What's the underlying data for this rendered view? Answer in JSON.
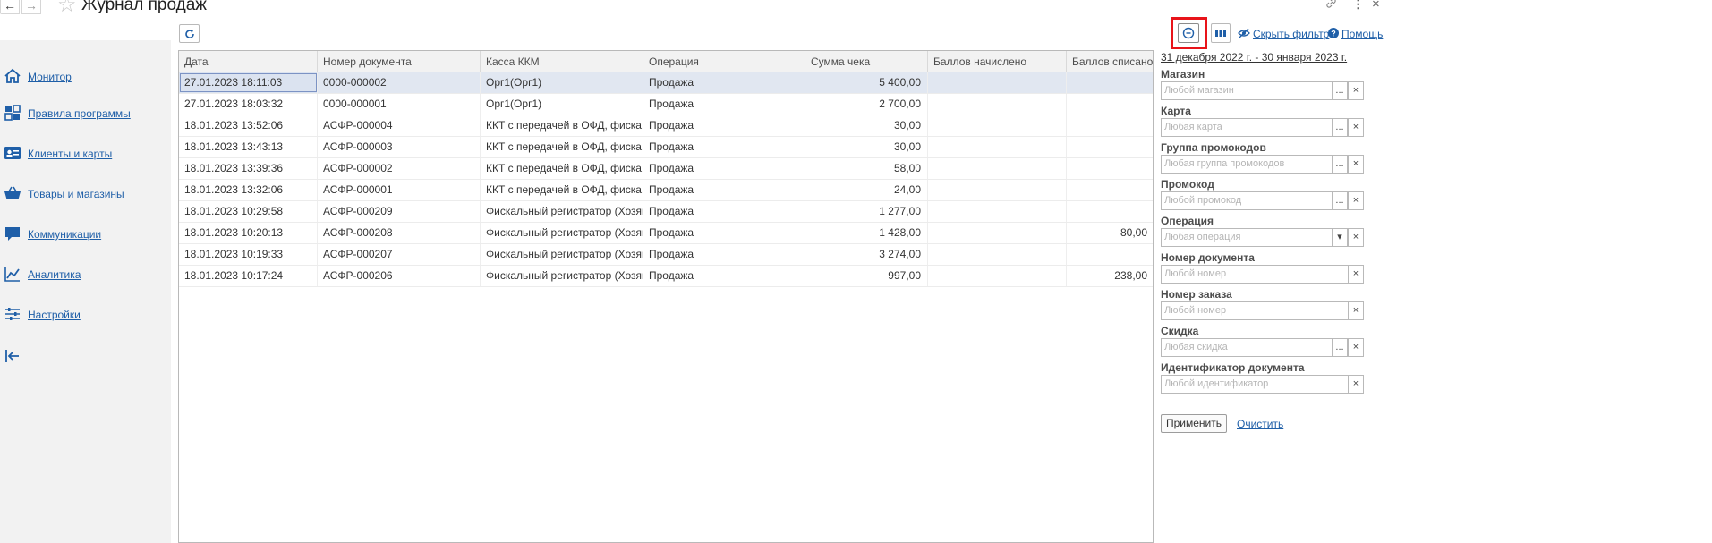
{
  "window": {
    "title": "Журнал продаж"
  },
  "icons": {
    "back": "arrow-left-icon",
    "forward": "arrow-right-icon",
    "favorite": "star-icon",
    "link": "link-icon",
    "more": "more-vertical-icon",
    "close": "close-icon",
    "refresh": "refresh-icon",
    "filter_toggle": "minus-circle-icon",
    "columns": "columns-icon",
    "hide_filter": "eye-off-icon",
    "help": "help-icon",
    "collapse": "collapse-left-icon"
  },
  "glyphs": {
    "back": "←",
    "forward": "→",
    "favorite": "☆",
    "link": "🔗",
    "more": "⋮",
    "close": "×",
    "dots": "...",
    "clear": "×",
    "dropdown": "▾"
  },
  "sidebar": {
    "items": [
      {
        "label": "Монитор",
        "icon": "home-icon"
      },
      {
        "label": "Правила программы",
        "icon": "dashboard-icon"
      },
      {
        "label": "Клиенты и карты",
        "icon": "id-card-icon"
      },
      {
        "label": "Товары и магазины",
        "icon": "basket-icon"
      },
      {
        "label": "Коммуникации",
        "icon": "chat-icon"
      },
      {
        "label": "Аналитика",
        "icon": "chart-line-icon"
      },
      {
        "label": "Настройки",
        "icon": "sliders-icon"
      }
    ]
  },
  "toolbar": {
    "hide_filter_label": "Скрыть фильтр",
    "help_label": "Помощь"
  },
  "table": {
    "columns": [
      "Дата",
      "Номер документа",
      "Касса ККМ",
      "Операция",
      "Сумма чека",
      "Баллов начислено",
      "Баллов списано"
    ],
    "rows": [
      [
        "27.01.2023 18:11:03",
        "0000-000002",
        "Орг1(Орг1)",
        "Продажа",
        "5 400,00",
        "",
        ""
      ],
      [
        "27.01.2023 18:03:32",
        "0000-000001",
        "Орг1(Орг1)",
        "Продажа",
        "2 700,00",
        "",
        ""
      ],
      [
        "18.01.2023 13:52:06",
        "АСФР-000004",
        "ККТ с передачей в ОФД, фиска...",
        "Продажа",
        "30,00",
        "",
        ""
      ],
      [
        "18.01.2023 13:43:13",
        "АСФР-000003",
        "ККТ с передачей в ОФД, фиска...",
        "Продажа",
        "30,00",
        "",
        ""
      ],
      [
        "18.01.2023 13:39:36",
        "АСФР-000002",
        "ККТ с передачей в ОФД, фиска...",
        "Продажа",
        "58,00",
        "",
        ""
      ],
      [
        "18.01.2023 13:32:06",
        "АСФР-000001",
        "ККТ с передачей в ОФД, фиска...",
        "Продажа",
        "24,00",
        "",
        ""
      ],
      [
        "18.01.2023 10:29:58",
        "АСФР-000209",
        "Фискальный регистратор (Хозяй...",
        "Продажа",
        "1 277,00",
        "",
        ""
      ],
      [
        "18.01.2023 10:20:13",
        "АСФР-000208",
        "Фискальный регистратор (Хозяй...",
        "Продажа",
        "1 428,00",
        "",
        "80,00"
      ],
      [
        "18.01.2023 10:19:33",
        "АСФР-000207",
        "Фискальный регистратор (Хозяй...",
        "Продажа",
        "3 274,00",
        "",
        ""
      ],
      [
        "18.01.2023 10:17:24",
        "АСФР-000206",
        "Фискальный регистратор (Хозяй...",
        "Продажа",
        "997,00",
        "",
        "238,00"
      ]
    ]
  },
  "filter": {
    "period": "31 декабря 2022 г. - 30 января 2023 г.",
    "fields": [
      {
        "label": "Магазин",
        "placeholder": "Любой магазин",
        "buttons": [
          "dots",
          "clear"
        ]
      },
      {
        "label": "Карта",
        "placeholder": "Любая карта",
        "buttons": [
          "dots",
          "clear"
        ]
      },
      {
        "label": "Группа промокодов",
        "placeholder": "Любая группа промокодов",
        "buttons": [
          "dots",
          "clear"
        ]
      },
      {
        "label": "Промокод",
        "placeholder": "Любой промокод",
        "buttons": [
          "dots",
          "clear"
        ]
      },
      {
        "label": "Операция",
        "placeholder": "Любая операция",
        "buttons": [
          "dropdown",
          "clear"
        ]
      },
      {
        "label": "Номер документа",
        "placeholder": "Любой номер",
        "buttons": [
          "clear"
        ]
      },
      {
        "label": "Номер заказа",
        "placeholder": "Любой номер",
        "buttons": [
          "clear"
        ]
      },
      {
        "label": "Скидка",
        "placeholder": "Любая скидка",
        "buttons": [
          "dots",
          "clear"
        ]
      },
      {
        "label": "Идентификатор документа",
        "placeholder": "Любой идентификатор",
        "buttons": [
          "clear"
        ]
      }
    ],
    "apply_label": "Применить",
    "clear_label": "Очистить"
  },
  "colors": {
    "link": "#1f5fa8",
    "highlight": "#e8141a",
    "selected_row": "#e1e7f1",
    "sidebar_bg": "#f2f2f2"
  }
}
